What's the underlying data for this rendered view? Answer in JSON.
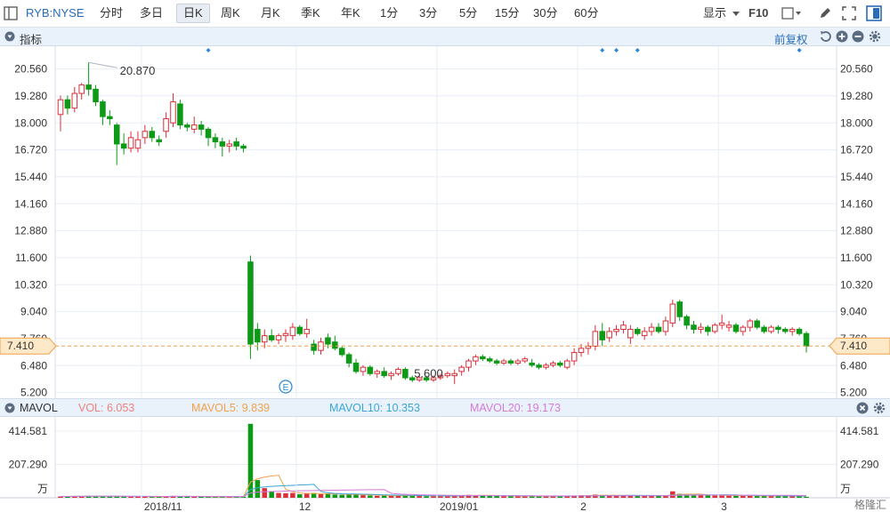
{
  "toolbar": {
    "symbol": "RYB:NYSE",
    "tabs": [
      "分时",
      "多日",
      "日K",
      "周K",
      "月K",
      "季K",
      "年K",
      "1分",
      "3分",
      "5分",
      "15分",
      "30分",
      "60分"
    ],
    "active_tab": "日K",
    "display_label": "显示",
    "f10_label": "F10"
  },
  "indicator_bar": {
    "title": "指标",
    "adjust_label": "前复权"
  },
  "volume_bar": {
    "title": "MAVOL",
    "items": [
      {
        "label": "VOL: 6.053",
        "color": "#f0807a"
      },
      {
        "label": "MAVOL5: 9.839",
        "color": "#f2a04a"
      },
      {
        "label": "MAVOL10: 10.353",
        "color": "#3aa6d8"
      },
      {
        "label": "MAVOL20: 19.173",
        "color": "#d47ad8"
      }
    ]
  },
  "colors": {
    "up": "#d9303a",
    "down": "#0d9a16",
    "grid": "#e8edf4",
    "axis_text": "#333333",
    "current": "#f0a048"
  },
  "watermark": "格隆汇",
  "chart_data": {
    "type": "candlestick",
    "price_axis": {
      "ticks": [
        "20.560",
        "19.280",
        "18.000",
        "16.720",
        "15.440",
        "14.160",
        "12.880",
        "11.600",
        "10.320",
        "9.040",
        "7.760",
        "6.480",
        "5.200"
      ],
      "ylim": [
        4.93,
        21.64
      ]
    },
    "volume_axis": {
      "ticks": [
        "414.581",
        "207.290"
      ],
      "unit": "万",
      "ylim": [
        0,
        470
      ]
    },
    "x_labels": [
      {
        "label": "2018/11",
        "i": 12
      },
      {
        "label": "12",
        "i": 34
      },
      {
        "label": "2019/01",
        "i": 54
      },
      {
        "label": "2",
        "i": 74
      },
      {
        "label": "3",
        "i": 94
      }
    ],
    "current_price": "7.410",
    "annotations": [
      {
        "label": "20.870",
        "i": 4
      },
      {
        "label": "5.600",
        "i": 51
      }
    ],
    "event_markers": [
      21,
      77,
      79,
      82,
      105
    ],
    "earnings_marker": {
      "label": "E",
      "i": 32
    },
    "candles": [
      {
        "o": 18.4,
        "h": 19.3,
        "l": 17.6,
        "c": 19.1,
        "v": 8
      },
      {
        "o": 19.1,
        "h": 19.3,
        "l": 18.4,
        "c": 18.7,
        "v": 9
      },
      {
        "o": 18.7,
        "h": 19.7,
        "l": 18.5,
        "c": 19.4,
        "v": 10
      },
      {
        "o": 19.4,
        "h": 19.9,
        "l": 19.1,
        "c": 19.8,
        "v": 9
      },
      {
        "o": 19.8,
        "h": 20.87,
        "l": 19.3,
        "c": 19.6,
        "v": 12
      },
      {
        "o": 19.6,
        "h": 19.8,
        "l": 18.8,
        "c": 19.0,
        "v": 11
      },
      {
        "o": 19.0,
        "h": 19.1,
        "l": 17.9,
        "c": 18.3,
        "v": 9
      },
      {
        "o": 18.3,
        "h": 18.6,
        "l": 17.9,
        "c": 18.2,
        "v": 8
      },
      {
        "o": 17.9,
        "h": 18.0,
        "l": 16.0,
        "c": 17.0,
        "v": 10
      },
      {
        "o": 17.0,
        "h": 17.5,
        "l": 16.5,
        "c": 16.8,
        "v": 8
      },
      {
        "o": 16.8,
        "h": 17.6,
        "l": 16.6,
        "c": 17.3,
        "v": 7
      },
      {
        "o": 16.8,
        "h": 17.6,
        "l": 16.6,
        "c": 17.2,
        "v": 8
      },
      {
        "o": 17.3,
        "h": 17.9,
        "l": 17.0,
        "c": 17.6,
        "v": 7
      },
      {
        "o": 17.6,
        "h": 17.8,
        "l": 17.1,
        "c": 17.3,
        "v": 6
      },
      {
        "o": 17.2,
        "h": 17.4,
        "l": 16.9,
        "c": 17.1,
        "v": 6
      },
      {
        "o": 17.6,
        "h": 18.5,
        "l": 17.3,
        "c": 18.2,
        "v": 10
      },
      {
        "o": 18.0,
        "h": 19.4,
        "l": 17.8,
        "c": 19.0,
        "v": 12
      },
      {
        "o": 18.9,
        "h": 19.1,
        "l": 17.7,
        "c": 17.9,
        "v": 9
      },
      {
        "o": 17.9,
        "h": 18.0,
        "l": 17.6,
        "c": 17.8,
        "v": 7
      },
      {
        "o": 17.7,
        "h": 18.3,
        "l": 17.5,
        "c": 17.9,
        "v": 6
      },
      {
        "o": 17.9,
        "h": 18.1,
        "l": 17.4,
        "c": 17.7,
        "v": 6
      },
      {
        "o": 17.7,
        "h": 17.8,
        "l": 16.9,
        "c": 17.3,
        "v": 7
      },
      {
        "o": 17.3,
        "h": 17.5,
        "l": 16.8,
        "c": 17.1,
        "v": 6
      },
      {
        "o": 17.1,
        "h": 17.3,
        "l": 16.4,
        "c": 16.9,
        "v": 7
      },
      {
        "o": 16.9,
        "h": 17.2,
        "l": 16.6,
        "c": 17.0,
        "v": 6
      },
      {
        "o": 17.1,
        "h": 17.3,
        "l": 16.7,
        "c": 16.9,
        "v": 6
      },
      {
        "o": 16.9,
        "h": 17.0,
        "l": 16.6,
        "c": 16.8,
        "v": 7
      },
      {
        "o": 11.4,
        "h": 11.7,
        "l": 6.8,
        "c": 7.5,
        "v": 460
      },
      {
        "o": 8.2,
        "h": 8.5,
        "l": 7.2,
        "c": 7.6,
        "v": 110
      },
      {
        "o": 7.6,
        "h": 8.2,
        "l": 7.3,
        "c": 7.9,
        "v": 60
      },
      {
        "o": 7.9,
        "h": 8.2,
        "l": 7.6,
        "c": 7.7,
        "v": 40
      },
      {
        "o": 7.7,
        "h": 8.0,
        "l": 7.5,
        "c": 7.9,
        "v": 30
      },
      {
        "o": 7.9,
        "h": 8.2,
        "l": 7.6,
        "c": 8.0,
        "v": 28
      },
      {
        "o": 7.9,
        "h": 8.5,
        "l": 7.7,
        "c": 8.3,
        "v": 30
      },
      {
        "o": 8.3,
        "h": 8.4,
        "l": 7.9,
        "c": 8.0,
        "v": 22
      },
      {
        "o": 8.0,
        "h": 8.7,
        "l": 7.8,
        "c": 8.2,
        "v": 25
      },
      {
        "o": 7.5,
        "h": 7.7,
        "l": 7.0,
        "c": 7.2,
        "v": 30
      },
      {
        "o": 7.2,
        "h": 7.8,
        "l": 7.0,
        "c": 7.6,
        "v": 22
      },
      {
        "o": 7.8,
        "h": 8.0,
        "l": 7.3,
        "c": 7.5,
        "v": 24
      },
      {
        "o": 7.6,
        "h": 7.9,
        "l": 7.2,
        "c": 7.3,
        "v": 20
      },
      {
        "o": 7.3,
        "h": 7.4,
        "l": 6.9,
        "c": 7.0,
        "v": 18
      },
      {
        "o": 7.0,
        "h": 7.1,
        "l": 6.4,
        "c": 6.6,
        "v": 20
      },
      {
        "o": 6.6,
        "h": 6.8,
        "l": 6.1,
        "c": 6.2,
        "v": 22
      },
      {
        "o": 6.2,
        "h": 6.5,
        "l": 6.0,
        "c": 6.4,
        "v": 16
      },
      {
        "o": 6.4,
        "h": 6.5,
        "l": 6.0,
        "c": 6.1,
        "v": 14
      },
      {
        "o": 6.1,
        "h": 6.3,
        "l": 5.9,
        "c": 6.2,
        "v": 12
      },
      {
        "o": 6.2,
        "h": 6.4,
        "l": 5.9,
        "c": 6.0,
        "v": 13
      },
      {
        "o": 6.0,
        "h": 6.2,
        "l": 5.8,
        "c": 6.1,
        "v": 12
      },
      {
        "o": 6.1,
        "h": 6.4,
        "l": 6.0,
        "c": 6.3,
        "v": 14
      },
      {
        "o": 6.3,
        "h": 6.4,
        "l": 5.8,
        "c": 5.9,
        "v": 15
      },
      {
        "o": 5.9,
        "h": 6.0,
        "l": 5.7,
        "c": 5.8,
        "v": 12
      },
      {
        "o": 5.8,
        "h": 6.0,
        "l": 5.7,
        "c": 5.9,
        "v": 11
      },
      {
        "o": 5.9,
        "h": 6.0,
        "l": 5.7,
        "c": 5.8,
        "v": 10
      },
      {
        "o": 5.8,
        "h": 6.0,
        "l": 5.7,
        "c": 5.9,
        "v": 9
      },
      {
        "o": 5.9,
        "h": 6.1,
        "l": 5.8,
        "c": 6.0,
        "v": 10
      },
      {
        "o": 6.0,
        "h": 6.2,
        "l": 5.9,
        "c": 6.1,
        "v": 12
      },
      {
        "o": 6.0,
        "h": 6.3,
        "l": 5.6,
        "c": 6.1,
        "v": 14
      },
      {
        "o": 6.2,
        "h": 6.5,
        "l": 6.0,
        "c": 6.4,
        "v": 15
      },
      {
        "o": 6.4,
        "h": 6.8,
        "l": 6.2,
        "c": 6.7,
        "v": 18
      },
      {
        "o": 6.7,
        "h": 7.0,
        "l": 6.5,
        "c": 6.9,
        "v": 16
      },
      {
        "o": 6.9,
        "h": 7.0,
        "l": 6.7,
        "c": 6.8,
        "v": 14
      },
      {
        "o": 6.8,
        "h": 6.9,
        "l": 6.6,
        "c": 6.7,
        "v": 12
      },
      {
        "o": 6.7,
        "h": 6.8,
        "l": 6.5,
        "c": 6.6,
        "v": 11
      },
      {
        "o": 6.6,
        "h": 6.8,
        "l": 6.5,
        "c": 6.7,
        "v": 10
      },
      {
        "o": 6.7,
        "h": 6.8,
        "l": 6.5,
        "c": 6.6,
        "v": 10
      },
      {
        "o": 6.6,
        "h": 6.8,
        "l": 6.5,
        "c": 6.7,
        "v": 9
      },
      {
        "o": 6.7,
        "h": 6.9,
        "l": 6.6,
        "c": 6.8,
        "v": 10
      },
      {
        "o": 6.6,
        "h": 6.8,
        "l": 6.4,
        "c": 6.5,
        "v": 10
      },
      {
        "o": 6.5,
        "h": 6.6,
        "l": 6.3,
        "c": 6.4,
        "v": 9
      },
      {
        "o": 6.4,
        "h": 6.6,
        "l": 6.3,
        "c": 6.5,
        "v": 10
      },
      {
        "o": 6.5,
        "h": 6.7,
        "l": 6.4,
        "c": 6.6,
        "v": 11
      },
      {
        "o": 6.6,
        "h": 6.7,
        "l": 6.4,
        "c": 6.5,
        "v": 10
      },
      {
        "o": 6.4,
        "h": 6.8,
        "l": 6.3,
        "c": 6.7,
        "v": 12
      },
      {
        "o": 6.7,
        "h": 7.3,
        "l": 6.5,
        "c": 7.1,
        "v": 14
      },
      {
        "o": 7.1,
        "h": 7.5,
        "l": 6.9,
        "c": 7.3,
        "v": 16
      },
      {
        "o": 7.3,
        "h": 7.6,
        "l": 7.0,
        "c": 7.4,
        "v": 15
      },
      {
        "o": 7.4,
        "h": 8.4,
        "l": 7.2,
        "c": 8.1,
        "v": 20
      },
      {
        "o": 8.1,
        "h": 8.5,
        "l": 7.4,
        "c": 7.7,
        "v": 16
      },
      {
        "o": 7.8,
        "h": 8.3,
        "l": 7.6,
        "c": 8.1,
        "v": 14
      },
      {
        "o": 8.1,
        "h": 8.4,
        "l": 7.9,
        "c": 8.2,
        "v": 13
      },
      {
        "o": 8.2,
        "h": 8.6,
        "l": 8.0,
        "c": 8.4,
        "v": 14
      },
      {
        "o": 7.8,
        "h": 8.4,
        "l": 7.5,
        "c": 8.2,
        "v": 15
      },
      {
        "o": 8.2,
        "h": 8.3,
        "l": 7.9,
        "c": 8.0,
        "v": 12
      },
      {
        "o": 7.9,
        "h": 8.3,
        "l": 7.7,
        "c": 8.1,
        "v": 12
      },
      {
        "o": 8.1,
        "h": 8.5,
        "l": 7.9,
        "c": 8.3,
        "v": 13
      },
      {
        "o": 8.3,
        "h": 8.5,
        "l": 8.0,
        "c": 8.1,
        "v": 12
      },
      {
        "o": 8.1,
        "h": 8.8,
        "l": 7.9,
        "c": 8.6,
        "v": 14
      },
      {
        "o": 8.5,
        "h": 9.6,
        "l": 8.3,
        "c": 9.4,
        "v": 40
      },
      {
        "o": 9.5,
        "h": 9.6,
        "l": 8.6,
        "c": 8.8,
        "v": 25
      },
      {
        "o": 8.8,
        "h": 8.9,
        "l": 8.2,
        "c": 8.4,
        "v": 18
      },
      {
        "o": 8.4,
        "h": 8.6,
        "l": 8.0,
        "c": 8.2,
        "v": 16
      },
      {
        "o": 8.2,
        "h": 8.5,
        "l": 8.0,
        "c": 8.3,
        "v": 15
      },
      {
        "o": 8.3,
        "h": 8.4,
        "l": 7.9,
        "c": 8.1,
        "v": 14
      },
      {
        "o": 8.1,
        "h": 8.5,
        "l": 8.0,
        "c": 8.4,
        "v": 14
      },
      {
        "o": 8.4,
        "h": 8.9,
        "l": 8.2,
        "c": 8.5,
        "v": 16
      },
      {
        "o": 8.3,
        "h": 8.6,
        "l": 8.1,
        "c": 8.4,
        "v": 13
      },
      {
        "o": 8.4,
        "h": 8.5,
        "l": 8.0,
        "c": 8.1,
        "v": 12
      },
      {
        "o": 8.1,
        "h": 8.4,
        "l": 7.9,
        "c": 8.3,
        "v": 12
      },
      {
        "o": 8.3,
        "h": 8.7,
        "l": 8.1,
        "c": 8.6,
        "v": 13
      },
      {
        "o": 8.6,
        "h": 8.7,
        "l": 8.2,
        "c": 8.3,
        "v": 12
      },
      {
        "o": 8.3,
        "h": 8.4,
        "l": 8.0,
        "c": 8.1,
        "v": 11
      },
      {
        "o": 8.1,
        "h": 8.4,
        "l": 8.0,
        "c": 8.3,
        "v": 11
      },
      {
        "o": 8.3,
        "h": 8.4,
        "l": 8.0,
        "c": 8.2,
        "v": 10
      },
      {
        "o": 8.2,
        "h": 8.3,
        "l": 8.0,
        "c": 8.1,
        "v": 10
      },
      {
        "o": 8.1,
        "h": 8.3,
        "l": 7.9,
        "c": 8.2,
        "v": 10
      },
      {
        "o": 8.2,
        "h": 8.3,
        "l": 7.9,
        "c": 8.0,
        "v": 10
      },
      {
        "o": 8.0,
        "h": 8.1,
        "l": 7.1,
        "c": 7.41,
        "v": 6
      }
    ]
  }
}
